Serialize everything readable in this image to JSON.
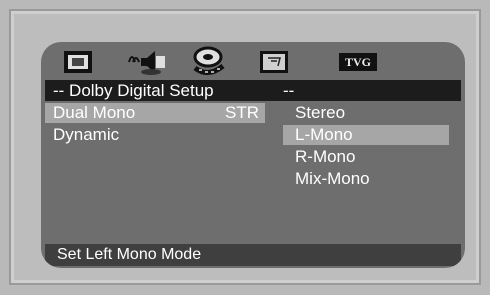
{
  "header": {
    "icons": [
      {
        "name": "general-setup-icon"
      },
      {
        "name": "audio-setup-icon"
      },
      {
        "name": "video-setup-icon"
      },
      {
        "name": "preference-icon"
      },
      {
        "name": "tvg-icon",
        "label": "TVG"
      }
    ],
    "title": "--  Dolby Digital Setup",
    "title_suffix": "--"
  },
  "settings": [
    {
      "label": "Dual Mono",
      "value": "STR"
    },
    {
      "label": "Dynamic",
      "value": ""
    }
  ],
  "options": [
    "Stereo",
    "L-Mono",
    "R-Mono",
    "Mix-Mono"
  ],
  "selected_option": "L-Mono",
  "status": "Set Left Mono Mode"
}
